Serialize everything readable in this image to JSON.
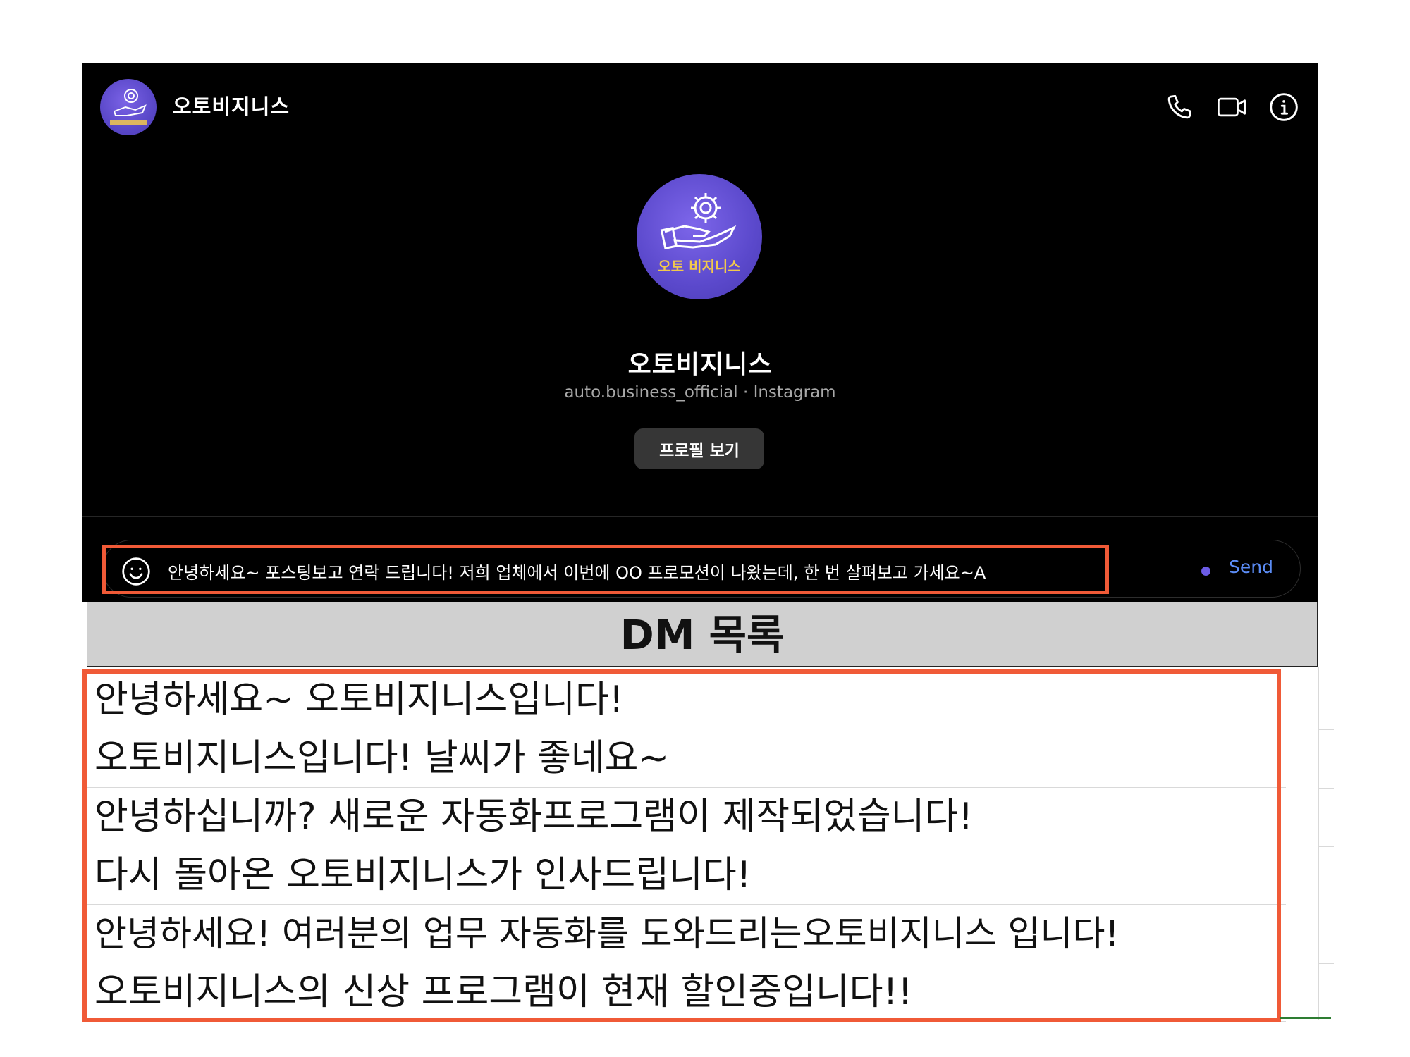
{
  "chat": {
    "header": {
      "title": "오토비지니스",
      "icons": [
        "phone-icon",
        "video-icon",
        "info-icon"
      ]
    },
    "profile": {
      "name": "오토비지니스",
      "subtitle": "auto.business_official · Instagram",
      "button_label": "프로필 보기",
      "logo_text": "오토 비지니스"
    },
    "composer": {
      "message": "안녕하세요~ 포스팅보고 연락 드립니다! 저희 업체에서 이번에 OO 프로모션이 나왔는데, 한 번 살펴보고 가세요~A",
      "send_label": "Send"
    }
  },
  "dm_list": {
    "title": "DM 목록",
    "rows": [
      "안녕하세요~ 오토비지니스입니다!",
      "오토비지니스입니다! 날씨가 좋네요~",
      "안녕하십니까? 새로운 자동화프로그램이 제작되었습니다!",
      "다시 돌아온 오토비지니스가 인사드립니다!",
      "안녕하세요! 여러분의 업무 자동화를 도와드리는오토비지니스 입니다!",
      "오토비지니스의 신상 프로그램이 현재 할인중입니다!!"
    ]
  },
  "colors": {
    "background": "#000000",
    "highlight": "#f05a37",
    "send": "#5b8cf5",
    "avatar": "#5a48c9",
    "button": "#363636",
    "logo_text": "#f2c94c"
  }
}
